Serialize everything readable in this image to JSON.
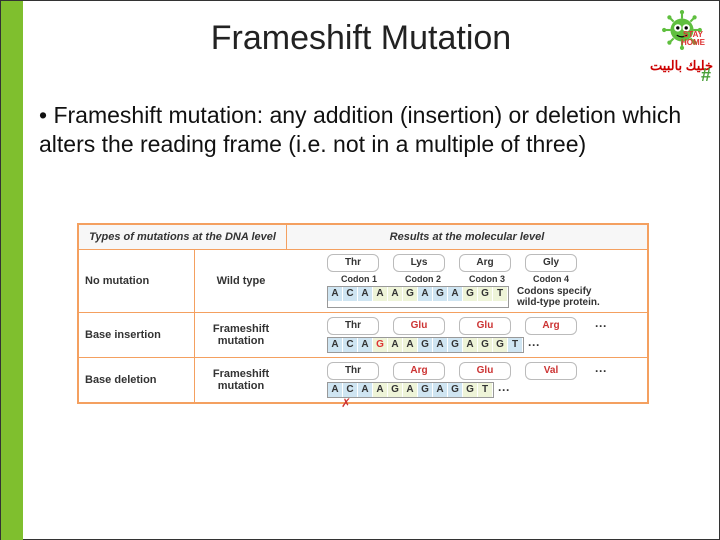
{
  "title": "Frameshift Mutation",
  "corner": {
    "arabic": "خليك بالبيت",
    "stay1": "STAY",
    "stay2": "HOME",
    "hash": "#"
  },
  "bullet": "Frameshift mutation: any addition (insertion) or deletion which alters the reading frame (i.e. not in a multiple of three)",
  "hdr": {
    "left": "Types of mutations at the DNA level",
    "right": "Results at the molecular level"
  },
  "r1": {
    "left": "No mutation",
    "sub": "Wild type",
    "aa": [
      "Thr",
      "Lys",
      "Arg",
      "Gly"
    ],
    "cod": [
      "Codon 1",
      "Codon 2",
      "Codon 3",
      "Codon 4"
    ],
    "seq": [
      [
        "A",
        "C",
        "A"
      ],
      [
        "A",
        "A",
        "G"
      ],
      [
        "A",
        "G",
        "A"
      ],
      [
        "G",
        "G",
        "T"
      ]
    ],
    "note": "Codons specify wild-type protein."
  },
  "r2": {
    "left": "Base insertion",
    "sub": "Frameshift mutation",
    "aa": [
      "Thr",
      "Glu",
      "Glu",
      "Arg"
    ],
    "seq": [
      [
        "A",
        "C",
        "A"
      ],
      [
        "G",
        "A",
        "A"
      ],
      [
        "G",
        "A",
        "G"
      ],
      [
        "A",
        "G",
        "G"
      ],
      [
        "T"
      ]
    ],
    "dots": "···"
  },
  "r3": {
    "left": "Base deletion",
    "sub": "Frameshift mutation",
    "aa": [
      "Thr",
      "Arg",
      "Glu",
      "Val"
    ],
    "seq": [
      [
        "A",
        "C",
        "A"
      ],
      [
        "A",
        "G",
        "A"
      ],
      [
        "G",
        "A",
        "G"
      ],
      [
        "G",
        "T"
      ]
    ],
    "dots": "···",
    "del": "✗"
  }
}
